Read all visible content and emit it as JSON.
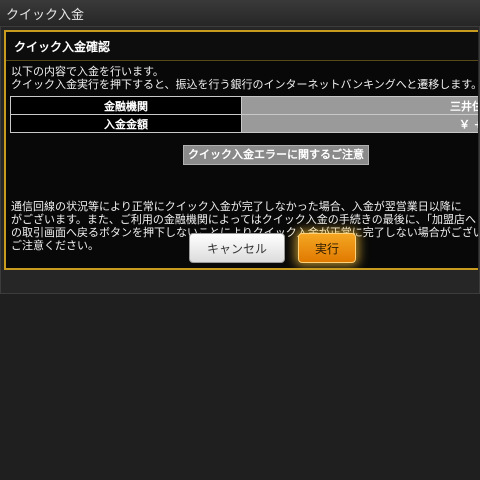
{
  "window": {
    "title": "クイック入金"
  },
  "dialog": {
    "title": "クイック入金確認",
    "intro_lines": [
      "以下の内容で入金を行います。",
      "クイック入金実行を押下すると、振込を行う銀行のインターネットバンキングへと遷移します。"
    ],
    "details": [
      {
        "label": "金融機関",
        "value": "三井住"
      },
      {
        "label": "入金金額",
        "value": "￥ +"
      }
    ],
    "error_link": "クイック入金エラーに関するご注意",
    "notice_lines": [
      "通信回線の状況等により正常にクイック入金が完了しなかった場合、入金が翌営業日以降に",
      "がございます。また、ご利用の金融機関によってはクイック入金の手続きの最後に、「加盟店へ",
      "の取引画面へ戻るボタンを押下しないことによりクイック入金が正常に完了しない場合がござい",
      "ご注意ください。"
    ],
    "cancel_label": "キャンセル",
    "execute_label": "実行"
  },
  "colors": {
    "frame_border": "#c89a1e",
    "execute_button": "#f09010",
    "background": "#1f1f1f"
  }
}
